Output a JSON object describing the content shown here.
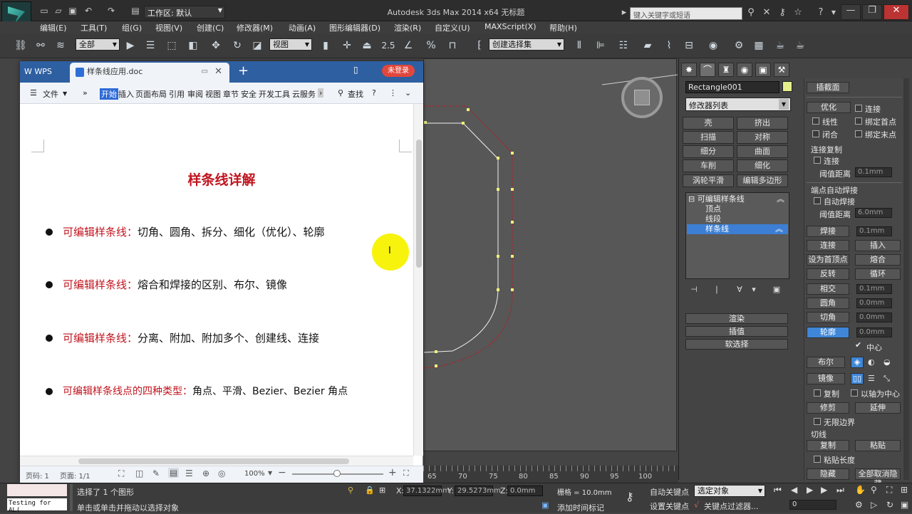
{
  "max": {
    "title": "Autodesk 3ds Max  2014 x64      无标题",
    "workspace": "工作区: 默认",
    "search_placeholder": "键入关键字或短语",
    "menus": [
      "编辑(E)",
      "工具(T)",
      "组(G)",
      "视图(V)",
      "创建(C)",
      "修改器(M)",
      "动画(A)",
      "图形编辑器(D)",
      "渲染(R)",
      "自定义(U)",
      "MAXScript(X)",
      "帮助(H)"
    ],
    "toolbar": {
      "filter": "全部",
      "refcoord": "视图",
      "snap_value": "2.5",
      "named_selection": "创建选择集"
    }
  },
  "panel": {
    "object_name": "Rectangle001",
    "object_color": "#e5f08c",
    "modifier_list": "修改器列表",
    "buttons": [
      [
        "壳",
        "挤出"
      ],
      [
        "扫描",
        "对称"
      ],
      [
        "细分",
        "曲面"
      ],
      [
        "车削",
        "细化"
      ],
      [
        "涡轮平滑",
        "编辑多边形"
      ]
    ],
    "stack": {
      "root": "可编辑样条线",
      "items": [
        "顶点",
        "线段",
        "样条线"
      ],
      "selected": "样条线"
    },
    "rollouts": [
      "渲染",
      "插值",
      "软选择"
    ]
  },
  "geometry": {
    "title": "插截面",
    "rows": [
      {
        "button": "优化",
        "check": "连接"
      },
      {
        "check_a": "线性",
        "check_b": "绑定首点"
      },
      {
        "check_a": "闭合",
        "check_b": "绑定末点"
      }
    ],
    "connect_copy_label": "连接复制",
    "connect_check": "连接",
    "threshold_label": "阈值距离",
    "threshold_value": "0.1mm",
    "endpoint_weld_label": "端点自动焊接",
    "auto_weld": "自动焊接",
    "threshold2_label": "阈值距离",
    "threshold2_value": "6.0mm",
    "ops": [
      {
        "label": "焊接",
        "value": "0.1mm"
      },
      {
        "label": "连接",
        "right": "插入"
      },
      {
        "label": "设为首顶点",
        "right": "熔合"
      },
      {
        "label": "反转",
        "right": "循环"
      },
      {
        "label": "相交",
        "value": "0.1mm"
      },
      {
        "label": "圆角",
        "value": "0.0mm"
      },
      {
        "label": "切角",
        "value": "0.0mm"
      },
      {
        "label": "轮廓",
        "value": "0.0mm"
      }
    ],
    "center": "中心",
    "boolean_label": "布尔",
    "mirror_label": "镜像",
    "copy_label": "复制",
    "axis_center_label": "以轴为中心",
    "trim_label": "修剪",
    "extend_label": "延伸",
    "infinite_bounds": "无限边界",
    "tangent_label": "切线",
    "copy_btn": "复制",
    "paste_btn": "粘贴",
    "paste_length": "粘贴长度",
    "hide_label": "隐藏",
    "unhide_all": "全部取消隐藏"
  },
  "wps": {
    "brand": "WPS",
    "doc_tab": "样条线应用.doc",
    "login": "未登录",
    "file_menu": "文件",
    "ribbon": [
      "开始",
      "插入",
      "页面布局",
      "引用",
      "审阅",
      "视图",
      "章节",
      "安全",
      "开发工具",
      "云服务"
    ],
    "active_ribbon": "开始",
    "search_label": "查找",
    "doc_title": "样条线详解",
    "bullets": [
      {
        "red": "可编辑样条线：",
        "black": "切角、圆角、拆分、细化（优化）、轮廓"
      },
      {
        "red": "可编辑样条线：",
        "black": "熔合和焊接的区别、布尔、镜像"
      },
      {
        "red": "可编辑样条线：",
        "black": "分离、附加、附加多个、创建线、连接"
      },
      {
        "red": "可编辑样条线点的四种类型：",
        "black": "角点、平滑、Bezier、Bezier 角点"
      }
    ],
    "status_page": "页码: 1",
    "status_pages": "页面: 1/1",
    "zoom": "100%"
  },
  "timeline": {
    "ticks": [
      "65",
      "70",
      "75",
      "80",
      "85",
      "90",
      "95",
      "100"
    ]
  },
  "status": {
    "selected": "选择了 1 个图形",
    "prompt": "单击或单击并拖动以选择对象",
    "x_label": "X:",
    "x_value": "37.1322mm",
    "y_label": "Y:",
    "y_value": "29.5273mm",
    "z_label": "Z:",
    "z_value": "0.0mm",
    "grid": "栅格 = 10.0mm",
    "add_time_tag": "添加时间标记",
    "auto_key": "自动关键点",
    "set_key": "设置关键点",
    "selected_objects": "选定对象",
    "key_filters": "关键点过滤器...",
    "frame": "0",
    "listener": "Testing for AL("
  }
}
